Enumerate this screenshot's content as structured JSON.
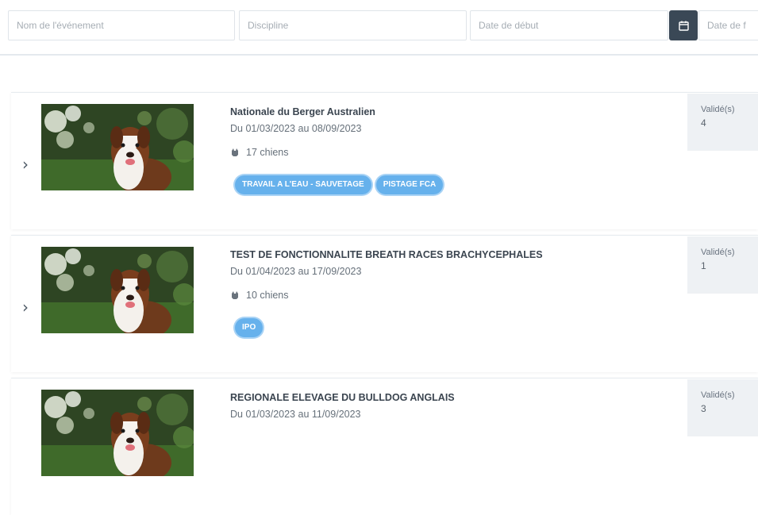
{
  "filters": {
    "event_name_placeholder": "Nom de l'événement",
    "discipline_placeholder": "Discipline",
    "start_date_placeholder": "Date de début",
    "end_date_placeholder": "Date de f"
  },
  "colors": {
    "calendar_button": "#3a4856",
    "tag": "#66b1ec",
    "status_bg": "#eef1f4"
  },
  "events": [
    {
      "title": "Nationale du Berger Australien",
      "dates": "Du 01/03/2023 au 08/09/2023",
      "dogs": "17 chiens",
      "tags": [
        "TRAVAIL A L'EAU - SAUVETAGE",
        "PISTAGE FCA"
      ],
      "status_label": "Validé(s)",
      "status_count": "4"
    },
    {
      "title": "TEST DE FONCTIONNALITE BREATH RACES BRACHYCEPHALES",
      "dates": "Du 01/04/2023 au 17/09/2023",
      "dogs": "10 chiens",
      "tags": [
        "IPO"
      ],
      "status_label": "Validé(s)",
      "status_count": "1"
    },
    {
      "title": "REGIONALE ELEVAGE DU BULLDOG ANGLAIS",
      "dates": "Du 01/03/2023 au 11/09/2023",
      "dogs": "",
      "tags": [],
      "status_label": "Validé(s)",
      "status_count": "3"
    }
  ]
}
